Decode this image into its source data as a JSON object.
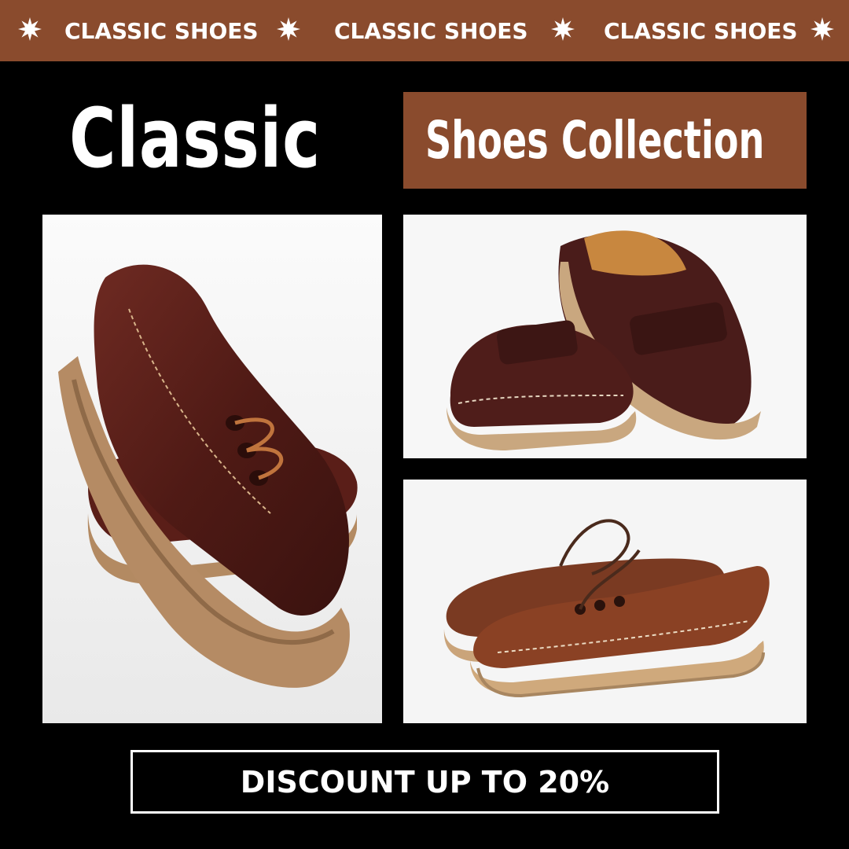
{
  "banner": {
    "items": [
      "CLASSIC SHOES",
      "CLASSIC SHOES",
      "CLASSIC SHOES"
    ],
    "separator_icon": "starburst-icon"
  },
  "headline": {
    "title": "Classic",
    "subtitle": "Shoes Collection"
  },
  "photos": [
    {
      "subject": "stacked-boat-shoes",
      "icon": "shoe-photo"
    },
    {
      "subject": "velcro-boat-shoes",
      "icon": "shoe-photo"
    },
    {
      "subject": "laced-boat-shoes-pair",
      "icon": "shoe-photo"
    }
  ],
  "cta": {
    "label": "DISCOUNT UP TO 20%"
  },
  "colors": {
    "background": "#000000",
    "accent": "#8a4b2d",
    "text": "#ffffff"
  }
}
